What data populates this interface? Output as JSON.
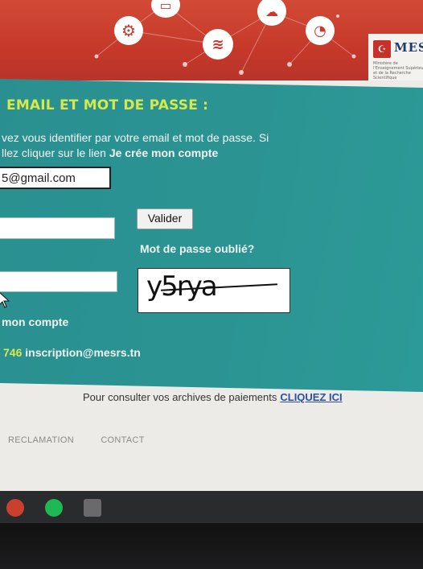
{
  "banner": {
    "logo_text": "MESR",
    "logo_flag_icon": "tunisia-flag-icon",
    "logo_subtitle": "Ministère de l'Enseignement Supérieur et de la Recherche Scientifique",
    "icons": [
      "gear-icon",
      "monitor-icon",
      "wifi-icon",
      "cloud-download-icon",
      "clock-icon"
    ]
  },
  "login": {
    "section_title": "EMAIL ET MOT DE PASSE :",
    "intro_line1": "vez vous identifier par votre email et mot de passe. Si",
    "intro_line2_prefix": "llez cliquer sur le lien ",
    "intro_line2_link": "Je crée mon compte",
    "email_value": "5@gmail.com",
    "password_value": "",
    "captcha_input_value": "",
    "submit_label": "Valider",
    "forgot_password": "Mot de passe oublié?",
    "captcha_text": "y5rya",
    "create_account_link": "mon compte",
    "contact_number": "746",
    "contact_email": "inscription@mesrs.tn"
  },
  "archives": {
    "text": "Pour consulter vos archives de paiements",
    "link": "CLIQUEZ ICI"
  },
  "footer": {
    "items": [
      "RECLAMATION",
      "CONTACT"
    ]
  },
  "colors": {
    "banner_red": "#c6392a",
    "panel_teal": "#2b9493",
    "title_yellow": "#d6e94a",
    "link_blue": "#2b4ea8"
  }
}
